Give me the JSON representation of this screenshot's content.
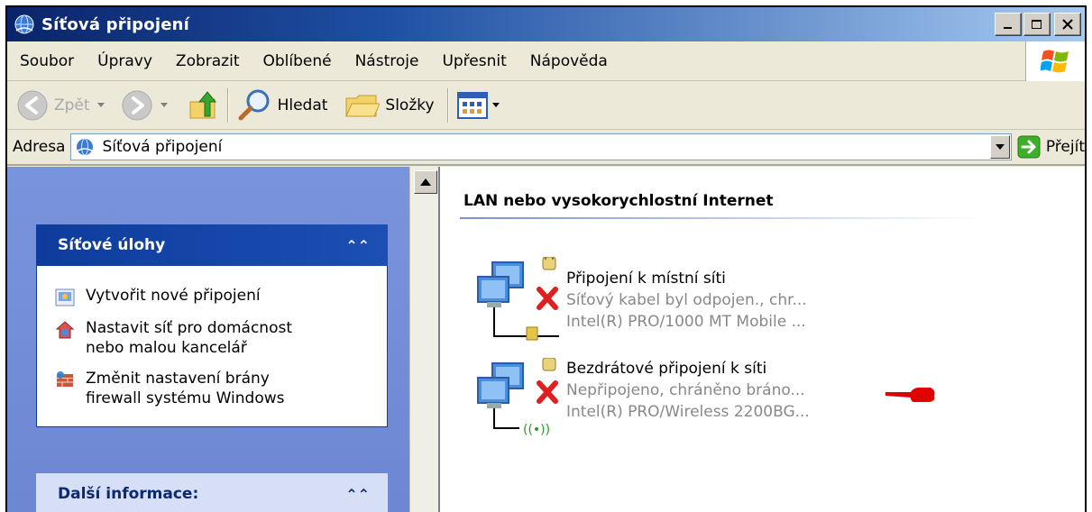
{
  "window": {
    "title": "Síťová připojení"
  },
  "menu": {
    "items": [
      "Soubor",
      "Úpravy",
      "Zobrazit",
      "Oblíbené",
      "Nástroje",
      "Upřesnit",
      "Nápověda"
    ]
  },
  "toolbar": {
    "back_label": "Zpět",
    "search_label": "Hledat",
    "folders_label": "Složky"
  },
  "address": {
    "label": "Adresa",
    "value": "Síťová připojení",
    "go_label": "Přejít"
  },
  "tasks_panel": {
    "title": "Síťové úlohy",
    "items": [
      {
        "lines": [
          "Vytvořit nové připojení"
        ],
        "icon": "new-connection-icon"
      },
      {
        "lines": [
          "Nastavit síť pro domácnost",
          "nebo malou kancelář"
        ],
        "icon": "home-network-icon"
      },
      {
        "lines": [
          "Změnit nastavení brány",
          "firewall systému Windows"
        ],
        "icon": "firewall-icon"
      }
    ]
  },
  "info_panel": {
    "title": "Další informace:"
  },
  "content": {
    "group_title": "LAN nebo vysokorychlostní Internet",
    "connections": [
      {
        "name": "Připojení k místní síti",
        "status": "Síťový kabel byl odpojen., chr...",
        "device": "Intel(R) PRO/1000 MT Mobile ..."
      },
      {
        "name": "Bezdrátové připojení k síti",
        "status": "Nepřipojeno, chráněno bráno...",
        "device": "Intel(R) PRO/Wireless 2200BG..."
      }
    ]
  },
  "colors": {
    "titlebar": "#0a246a",
    "panel_header": "#0d3c9c",
    "pointer": "#e00000"
  }
}
